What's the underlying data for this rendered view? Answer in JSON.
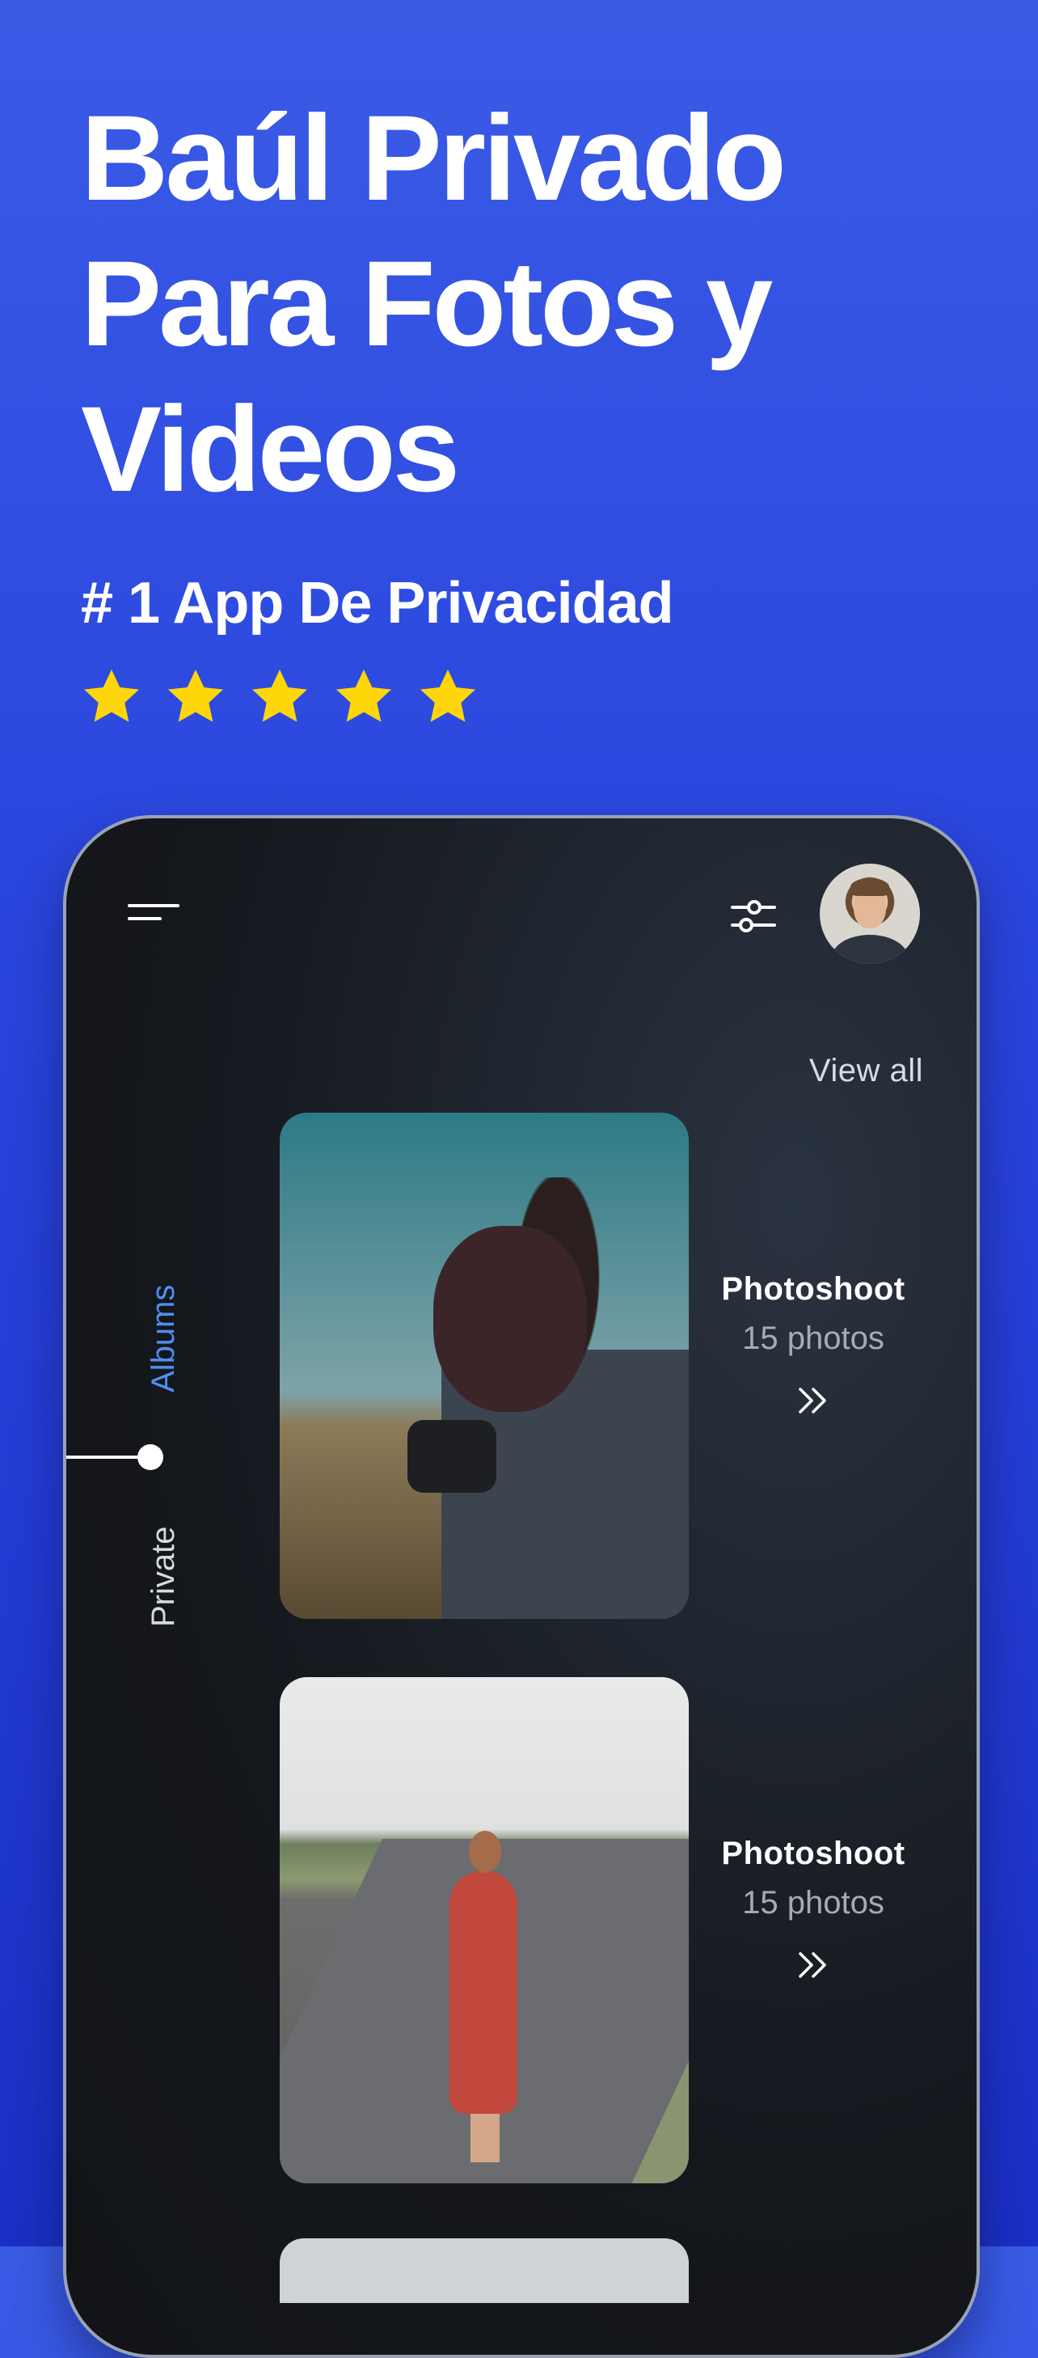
{
  "hero": {
    "title_line1": "Baúl Privado",
    "title_line2": "Para Fotos y",
    "title_line3": "Videos",
    "subtitle": "# 1  App De Privacidad",
    "rating_stars": 5,
    "star_color": "#FFD60A"
  },
  "app": {
    "header": {
      "menu_icon": "menu-icon",
      "filter_icon": "sliders-icon",
      "avatar": "user-avatar"
    },
    "view_all_label": "View all",
    "side_nav": {
      "items": [
        {
          "label": "Albums",
          "active": true
        },
        {
          "label": "Private",
          "active": false
        }
      ],
      "active_color": "#4F8EF0"
    },
    "albums": [
      {
        "title": "Photoshoot",
        "count": "15 photos",
        "arrow_icon": "double-chevron-right-icon"
      },
      {
        "title": "Photoshoot",
        "count": "15 photos",
        "arrow_icon": "double-chevron-right-icon"
      }
    ]
  },
  "colors": {
    "background_top": "#3A5BE6",
    "background_bottom": "#1A2FC4",
    "phone_surface": "#14171C"
  }
}
